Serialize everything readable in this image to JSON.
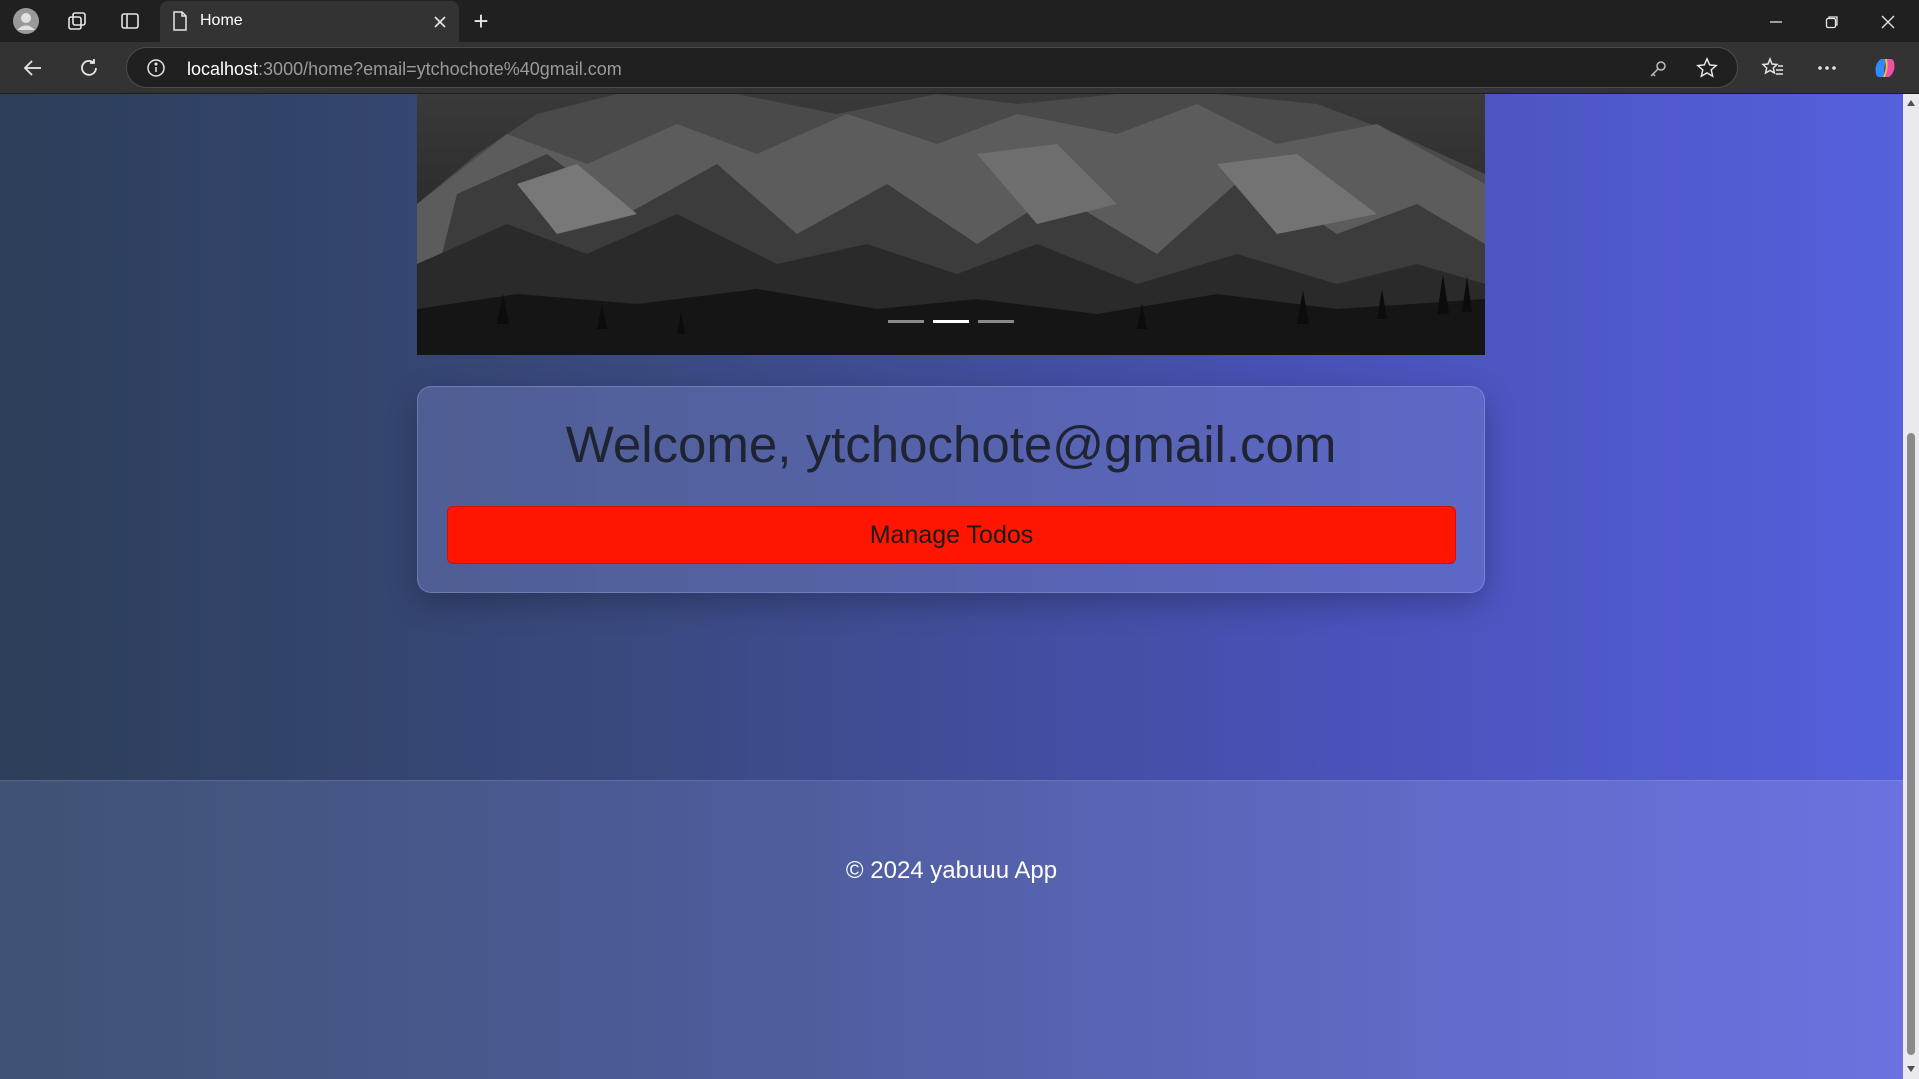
{
  "browser": {
    "tab_title": "Home",
    "new_tab_symbol": "+",
    "url_host": "localhost",
    "url_rest": ":3000/home?email=ytchochote%40gmail.com",
    "icons": [
      "profile-icon",
      "workspaces-icon",
      "tab-actions-icon",
      "page-icon",
      "close-icon",
      "new-tab-icon",
      "minimize-icon",
      "restore-icon",
      "window-close-icon",
      "back-icon",
      "refresh-icon",
      "site-info-icon",
      "key-icon",
      "favorite-star-icon",
      "favorites-icon",
      "more-icon",
      "copilot-icon"
    ]
  },
  "hero": {
    "indicator_count": 3,
    "active_indicator": 1
  },
  "welcome": {
    "heading": "Welcome, ytchochote@gmail.com",
    "manage_button_label": "Manage Todos",
    "button_color": "#ff1500"
  },
  "footer": {
    "text": "© 2024 yabuuu App"
  },
  "colors": {
    "chrome_dark": "#202020",
    "toolbar": "#333333",
    "accent_blue": "#5560dc"
  }
}
